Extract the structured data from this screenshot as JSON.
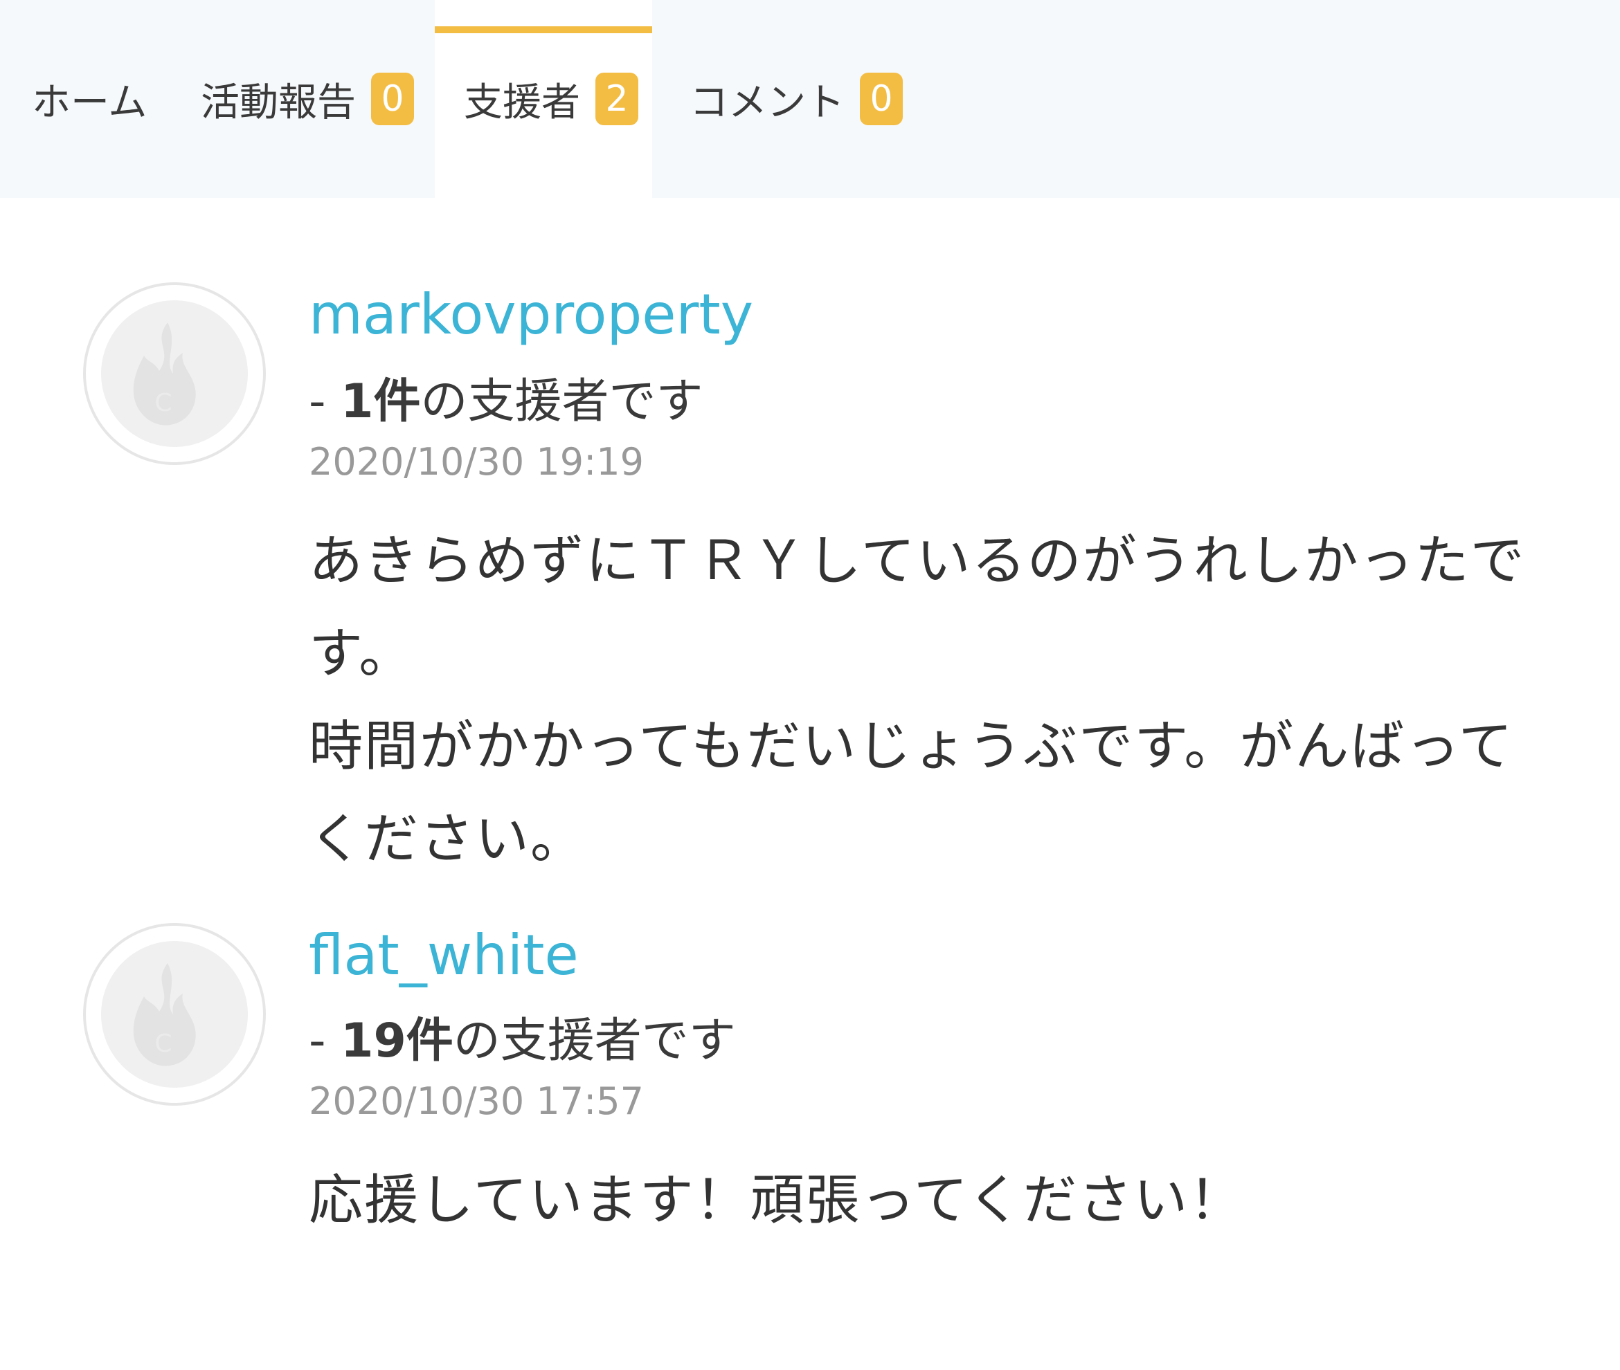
{
  "tabs": [
    {
      "label": "ホーム",
      "badge": null
    },
    {
      "label": "活動報告",
      "badge": "0"
    },
    {
      "label": "支援者",
      "badge": "2",
      "active": true
    },
    {
      "label": "コメント",
      "badge": "0"
    }
  ],
  "colors": {
    "accent": "#f3bd44",
    "username": "#3bb4d6",
    "tabbar_bg": "#f6f9fb",
    "date": "#999999"
  },
  "supporters": [
    {
      "avatar_icon": "camp-fire-icon",
      "username": "markovproperty",
      "count_prefix": "- ",
      "count_number": "1件",
      "count_suffix": "の支援者です",
      "date": "2020/10/30 19:19",
      "message_lines": [
        "あきらめずにＴＲＹしているのがうれしかったです。",
        "時間がかかってもだいじょうぶです。がんばってください。"
      ]
    },
    {
      "avatar_icon": "camp-fire-icon",
      "username": "flat_white",
      "count_prefix": "- ",
      "count_number": "19件",
      "count_suffix": "の支援者です",
      "date": "2020/10/30 17:57",
      "message_lines": [
        "応援しています！頑張ってください！"
      ]
    }
  ]
}
